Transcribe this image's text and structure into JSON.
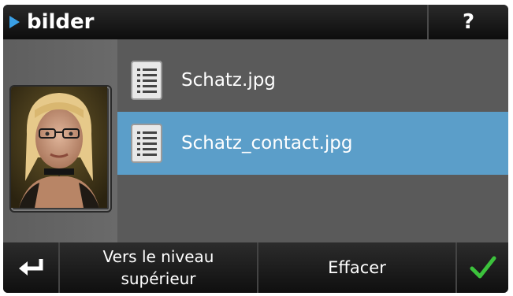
{
  "titlebar": {
    "folder_name": "bilder",
    "help_label": "?"
  },
  "preview": {
    "icon": "photo-thumbnail"
  },
  "files": [
    {
      "name": "Schatz.jpg",
      "selected": false,
      "icon": "document-icon"
    },
    {
      "name": "Schatz_contact.jpg",
      "selected": true,
      "icon": "document-icon"
    }
  ],
  "toolbar": {
    "back_icon": "return-arrow-icon",
    "up_label_line1": "Vers le niveau",
    "up_label_line2": "supérieur",
    "delete_label": "Effacer",
    "ok_icon": "checkmark-icon"
  },
  "colors": {
    "selection": "#5b9ec9",
    "accent_arrow": "#3aa0e6",
    "check_green": "#3cc23c"
  }
}
